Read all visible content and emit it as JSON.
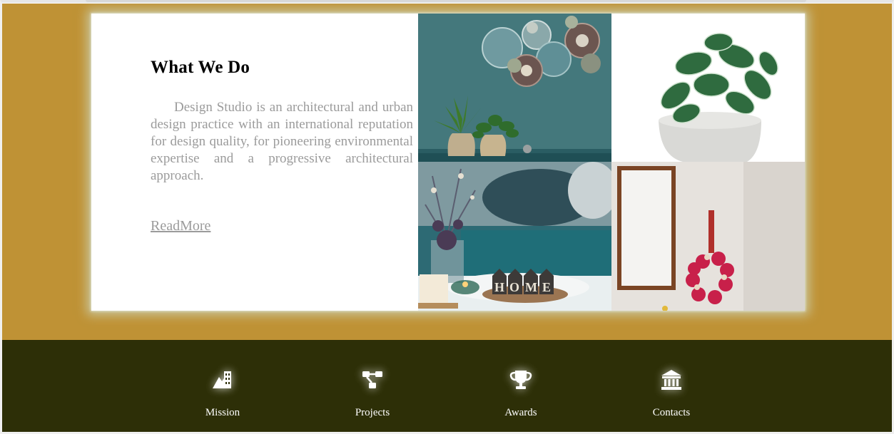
{
  "section": {
    "title": "What We Do",
    "description": "Design Studio is an architectural and urban design practice with an international reputation for design quality, for pioneering environmental expertise and a progressive architectural approach.",
    "read_more": "ReadMore"
  },
  "gallery": {
    "top_right_icon": "wall-plates-and-plants-photo",
    "house_letters": [
      "H",
      "O",
      "M",
      "E"
    ]
  },
  "footer": {
    "items": [
      {
        "label": "Mission",
        "icon": "mission-icon"
      },
      {
        "label": "Projects",
        "icon": "projects-icon"
      },
      {
        "label": "Awards",
        "icon": "trophy-icon"
      },
      {
        "label": "Contacts",
        "icon": "bank-icon"
      }
    ]
  },
  "colors": {
    "gold": "#bf9235",
    "footer": "#2d2f07",
    "text_gray": "#9b9b9b"
  }
}
